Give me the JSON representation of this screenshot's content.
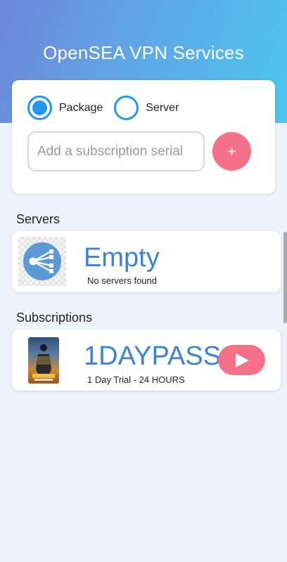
{
  "app": {
    "title": "OpenSEA VPN Services"
  },
  "mode": {
    "options": [
      {
        "label": "Package",
        "selected": true
      },
      {
        "label": "Server",
        "selected": false
      }
    ]
  },
  "subscription_input": {
    "value": "",
    "placeholder": "Add a subscription serial"
  },
  "add_button": {
    "label": "+"
  },
  "servers": {
    "title": "Servers",
    "name": "Empty",
    "message": "No servers found",
    "icon": "server-network-icon"
  },
  "subscriptions": {
    "title": "Subscriptions",
    "items": [
      {
        "name": "1DAYPASS",
        "detail": "1 Day Trial - 24 HOURS",
        "icon": "play-icon"
      }
    ]
  },
  "colors": {
    "header_start": "#6f86d8",
    "header_end": "#4cc6ee",
    "accent_blue": "#2196f3",
    "title_blue": "#3b83d3",
    "button_pink": "#f5718a",
    "background": "#eef3fb"
  }
}
